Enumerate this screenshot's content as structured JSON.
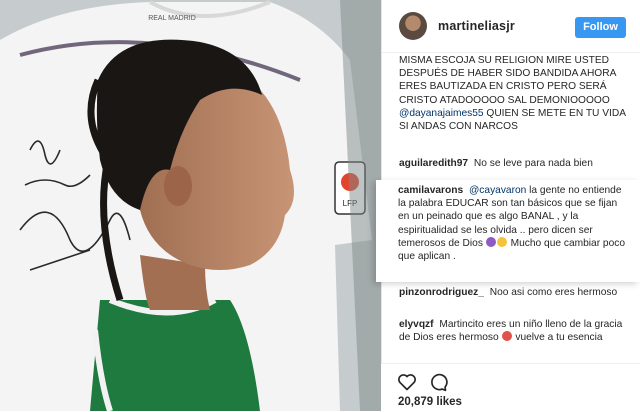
{
  "photo": {
    "shirt_brand": "REAL MADRID",
    "shirt_badge_label": "LFP",
    "autograph_text": "El grand\nPara Tezheta B.\nT.C."
  },
  "post": {
    "username": "martineliasjr",
    "follow_label": "Follow",
    "caption_tail": "MISMA ESCOJA SU RELIGION MIRE USTED DESPUÉS DE HABER SIDO BANDIDA AHORA ERES BAUTIZADA EN CRISTO PERO SERÁ CRISTO ATADOOOOO SAL DEMONIOOOOO",
    "caption_mention": "@dayanajaimes55",
    "caption_end": "QUIEN SE METE EN TU VIDA SI ANDAS CON NARCOS"
  },
  "comments": [
    {
      "user": "aguilaredith97",
      "text": "No se leve para nada bien"
    },
    {
      "user": "camilavarons",
      "mention": "@cayavaron",
      "text": "la gente no entiende la palabra EDUCAR son tan básicos que se fijan en un peinado que es algo BANAL , y la espiritualidad se les olvida .. pero dicen ser temerosos de Dios",
      "text_end": "Mucho que cambiar poco que aplican ."
    },
    {
      "user": "pinzonrodriguez_",
      "text": "Noo asi como eres hermoso"
    },
    {
      "user": "elyvqzf",
      "text": "Martincito eres un niño lleno de la gracia de Dios eres hermoso",
      "text_end": "vuelve a tu esencia"
    }
  ],
  "likes": "20,879 likes",
  "colors": {
    "follow": "#3897f0",
    "mention": "#003569",
    "jersey_green": "#1f7a3f"
  }
}
